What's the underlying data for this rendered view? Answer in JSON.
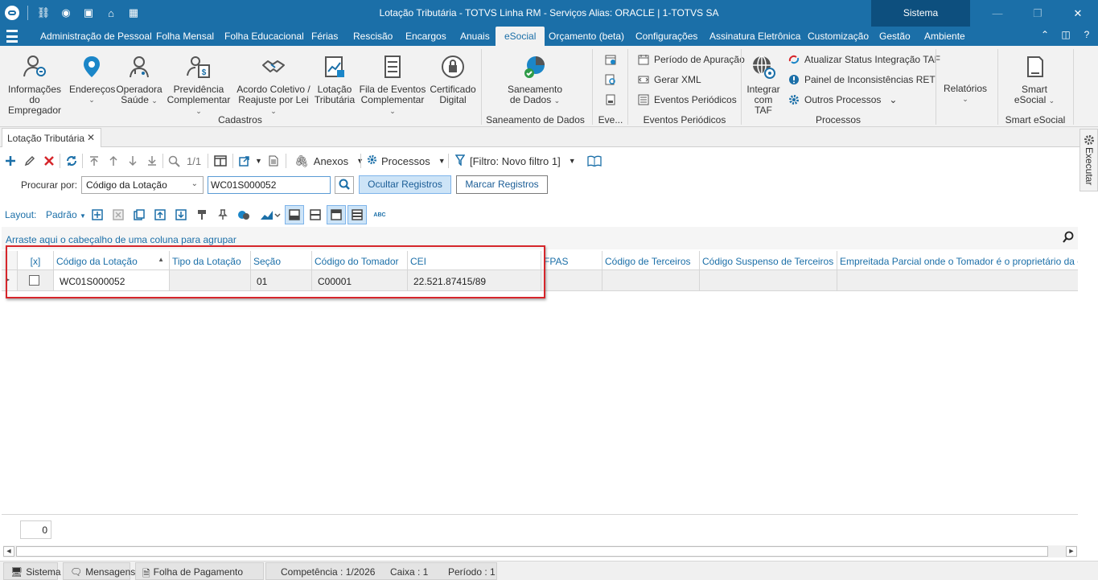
{
  "window": {
    "title": "Lotação Tributária - TOTVS Linha RM - Serviços  Alias: ORACLE | 1-TOTVS SA",
    "sistema_label": "Sistema"
  },
  "menu": {
    "items": [
      "Administração de Pessoal",
      "Folha Mensal",
      "Folha Educacional",
      "Férias",
      "Rescisão",
      "Encargos",
      "Anuais",
      "eSocial",
      "Orçamento (beta)",
      "Configurações",
      "Assinatura Eletrônica",
      "Customização",
      "Gestão",
      "Ambiente"
    ],
    "active": "eSocial"
  },
  "ribbon": {
    "cadastros": {
      "label": "Cadastros",
      "buttons": [
        {
          "l1": "Informações",
          "l2": "do Empregador"
        },
        {
          "l1": "Endereços",
          "l2": ""
        },
        {
          "l1": "Operadora",
          "l2": "Saúde"
        },
        {
          "l1": "Previdência",
          "l2": "Complementar"
        },
        {
          "l1": "Acordo Coletivo /",
          "l2": "Reajuste por Lei"
        },
        {
          "l1": "Lotação",
          "l2": "Tributária"
        },
        {
          "l1": "Fila de Eventos",
          "l2": "Complementar"
        },
        {
          "l1": "Certificado",
          "l2": "Digital"
        }
      ]
    },
    "saneamento": {
      "label": "Saneamento de Dados",
      "l1": "Saneamento",
      "l2": "de Dados"
    },
    "eventos_short": {
      "label": "Eve..."
    },
    "eventos_periodicos": {
      "label": "Eventos Periódicos",
      "items": [
        "Período de Apuração",
        "Gerar XML",
        "Eventos Periódicos"
      ]
    },
    "processos": {
      "label": "Processos",
      "integrar_l1": "Integrar",
      "integrar_l2": "com TAF",
      "items": [
        "Atualizar Status Integração TAF",
        "Painel de Inconsistências RET",
        "Outros Processos"
      ]
    },
    "relatorios": {
      "l1": "Relatórios"
    },
    "smart": {
      "label": "Smart eSocial",
      "l1": "Smart",
      "l2": "eSocial"
    }
  },
  "doc_tab": {
    "title": "Lotação Tributária"
  },
  "toolbar": {
    "pager": "1/1",
    "anexos": "Anexos",
    "processos": "Processos",
    "filtro": "[Filtro: Novo filtro 1]"
  },
  "search": {
    "label": "Procurar por:",
    "field": "Código da Lotação",
    "value": "WC01S000052",
    "hide_btn": "Ocultar Registros",
    "mark_btn": "Marcar Registros"
  },
  "layout": {
    "label": "Layout:",
    "value": "Padrão"
  },
  "grid": {
    "group_hint": "Arraste aqui o cabeçalho de uma coluna para agrupar",
    "columns": [
      "[x]",
      "Código da Lotação",
      "Tipo da Lotação",
      "Seção",
      "Código do Tomador",
      "CEI",
      "FPAS",
      "Código de Terceiros",
      "Código Suspenso de Terceiros",
      "Empreitada Parcial onde o Tomador é o proprietário da obra"
    ],
    "rows": [
      {
        "codigo": "WC01S000052",
        "tipo": "",
        "secao": "01",
        "tomador": "C00001",
        "cei": "22.521.87415/89"
      }
    ],
    "count": "0"
  },
  "side_panel": {
    "label": "Executar"
  },
  "statusbar": {
    "tabs": [
      "Sistema",
      "Mensagens",
      "Folha de Pagamento"
    ],
    "competencia": "Competência : 1/2026",
    "caixa": "Caixa : 1",
    "periodo": "Período : 1"
  },
  "colors": {
    "accent": "#1b6fa8",
    "dark_accent": "#0d4f7e",
    "highlight": "#d6262b"
  }
}
